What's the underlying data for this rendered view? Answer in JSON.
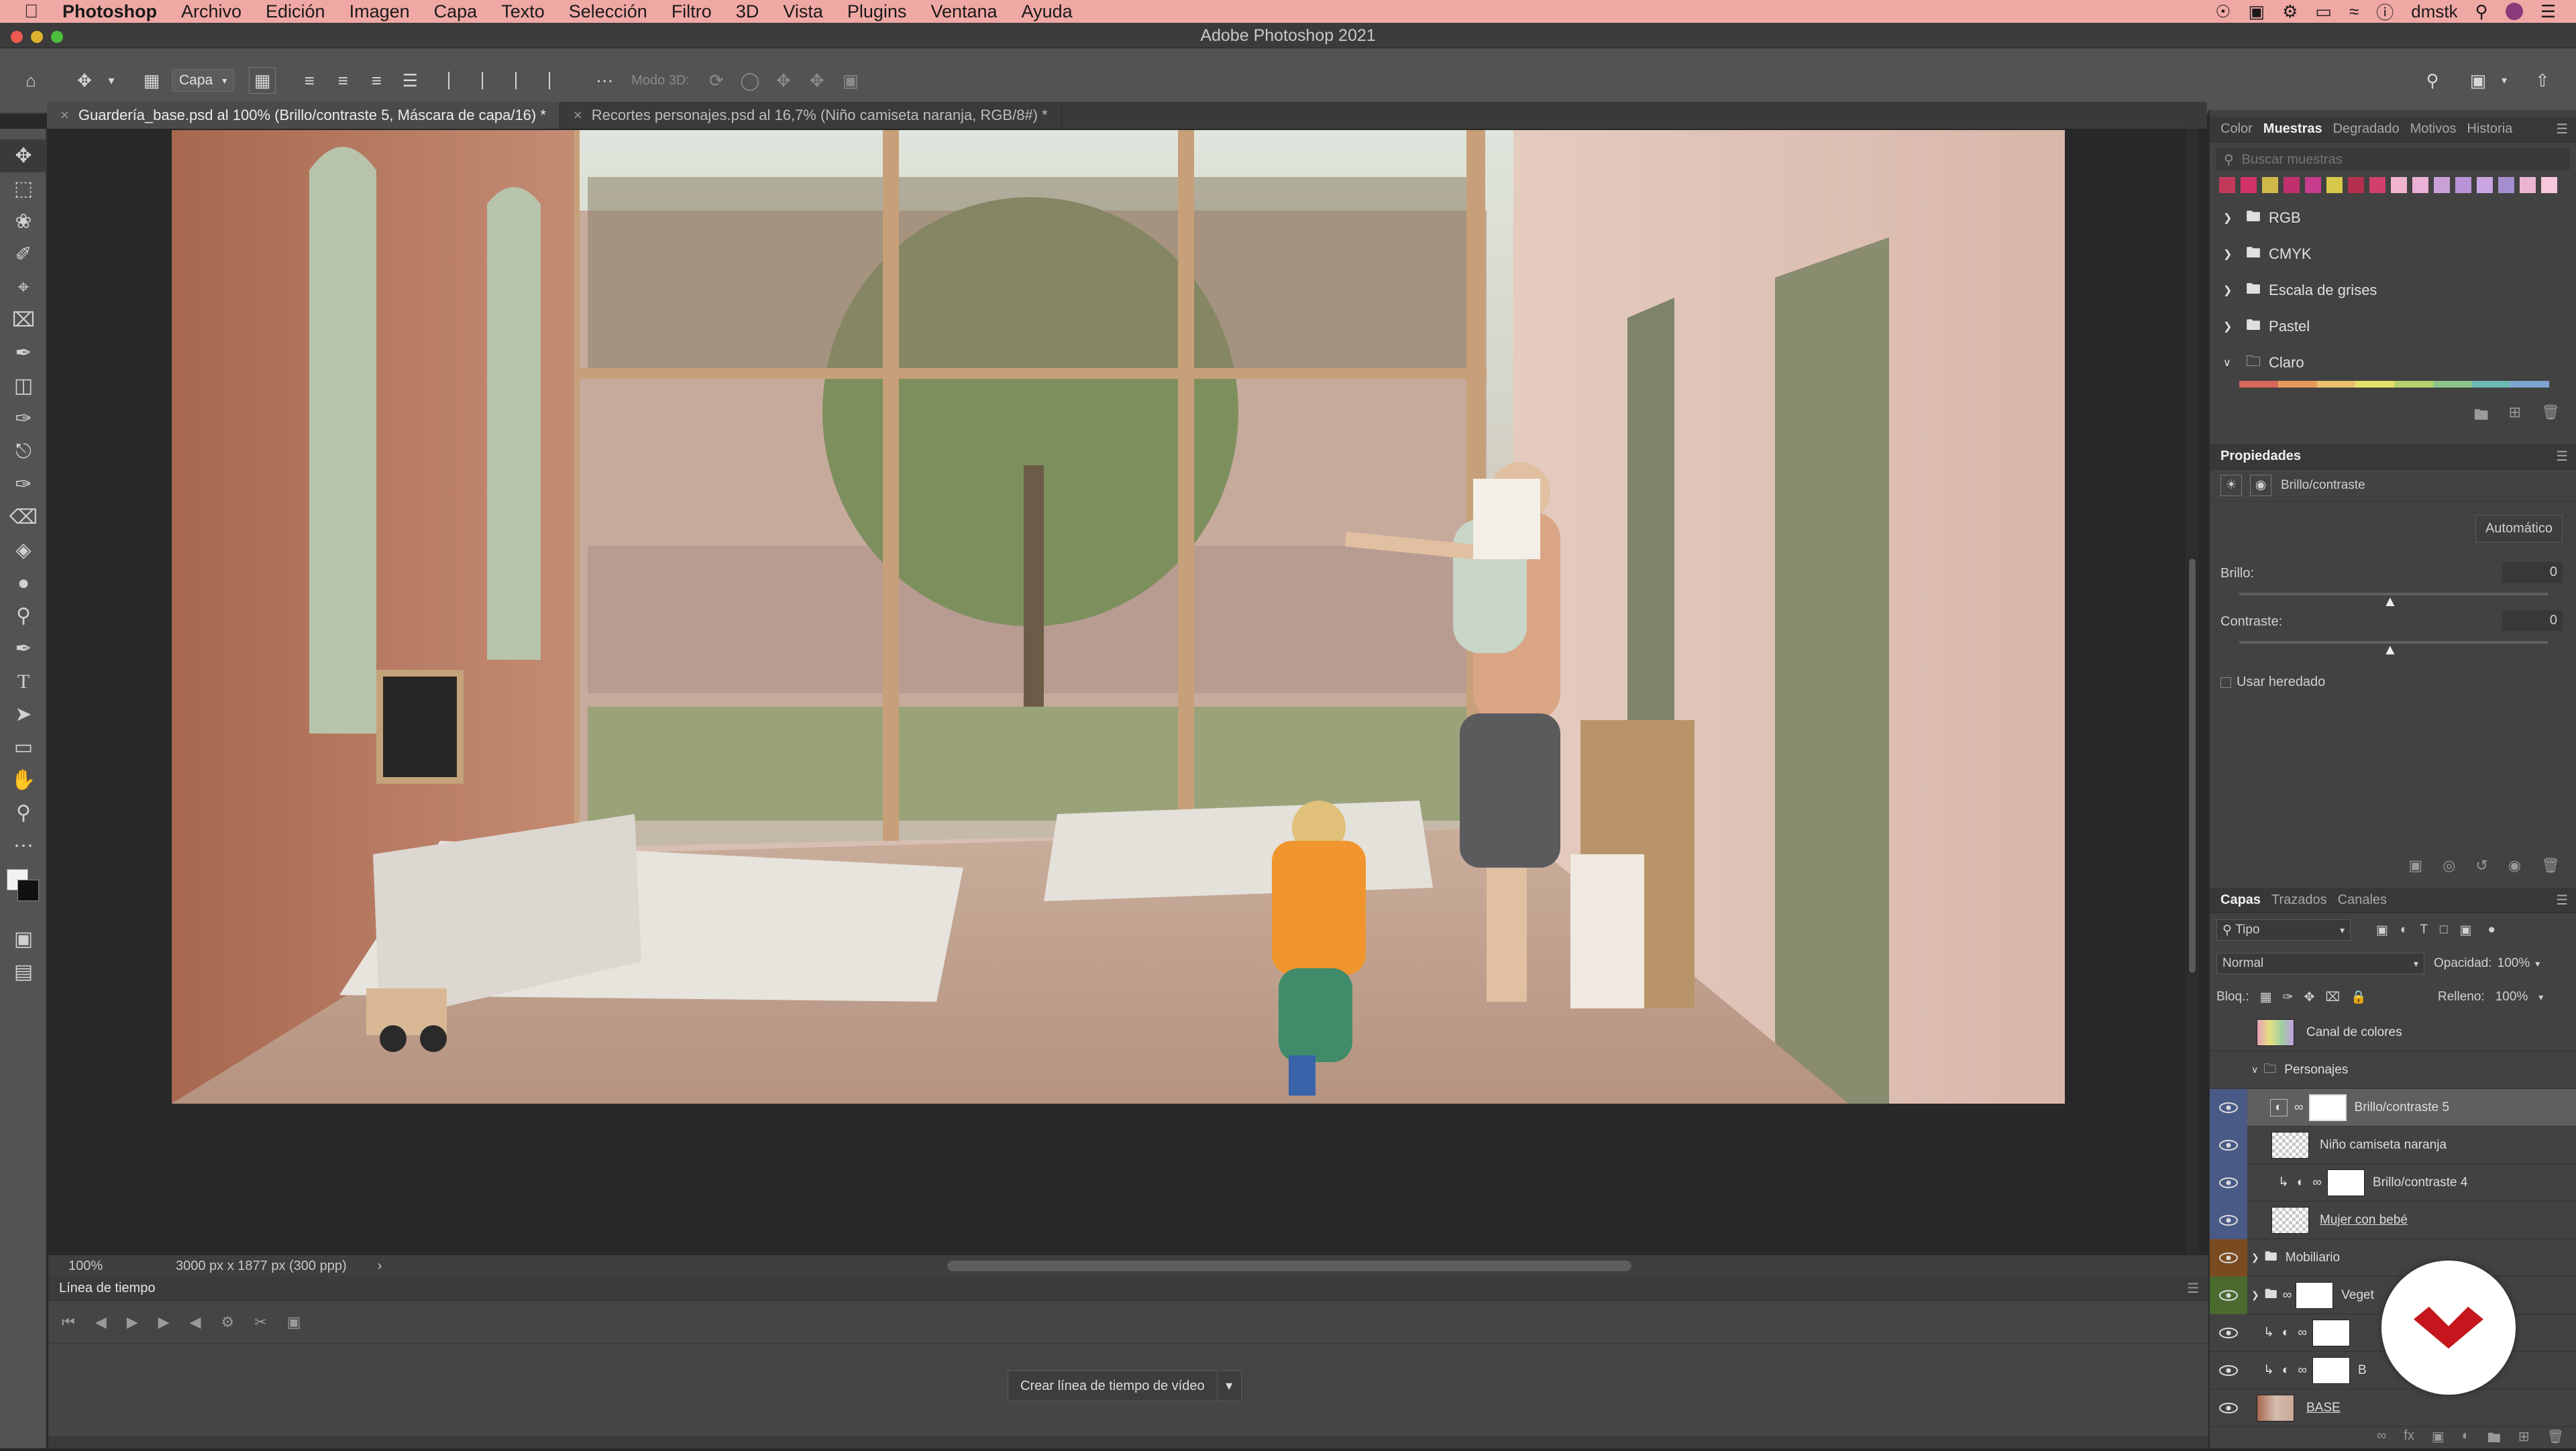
{
  "menubar": {
    "app_name": "Photoshop",
    "items": [
      "Archivo",
      "Edición",
      "Imagen",
      "Capa",
      "Texto",
      "Selección",
      "Filtro",
      "3D",
      "Vista",
      "Plugins",
      "Ventana",
      "Ayuda"
    ],
    "user": "dmstk"
  },
  "window": {
    "title": "Adobe Photoshop 2021"
  },
  "options_bar": {
    "layer_select": "Capa",
    "mode3d": "Modo 3D:"
  },
  "tabs": [
    {
      "label": "Guardería_base.psd al 100% (Brillo/contraste 5, Máscara de capa/16) *",
      "active": true
    },
    {
      "label": "Recortes personajes.psd al 16,7% (Niño camiseta naranja, RGB/8#) *",
      "active": false
    }
  ],
  "status": {
    "zoom": "100%",
    "doc_info": "3000 px x 1877 px (300 ppp)",
    "arrow": "›"
  },
  "timeline": {
    "title": "Línea de tiempo",
    "create_button": "Crear línea de tiempo de vídeo"
  },
  "swatches_panel": {
    "tabs": [
      "Color",
      "Muestras",
      "Degradado",
      "Motivos",
      "Historia"
    ],
    "active_tab": "Muestras",
    "search_placeholder": "Buscar muestras",
    "colors": [
      "#c23a5a",
      "#d33468",
      "#d0b84a",
      "#c22f6e",
      "#c53d8c",
      "#d7c84a",
      "#b5304c",
      "#d0406a",
      "#f0b4cc",
      "#eab0d6",
      "#c9a0d8",
      "#b894d6",
      "#c8a4e0",
      "#a48ecf",
      "#eab4d2",
      "#f6c6dc"
    ],
    "folders": [
      "RGB",
      "CMYK",
      "Escala de grises",
      "Pastel",
      "Claro"
    ],
    "strip_colors": [
      "#d7675a",
      "#e69a5c",
      "#eac16a",
      "#e8e06c",
      "#b6d26c",
      "#8cc48a",
      "#6cb8b4",
      "#7ea4d0"
    ]
  },
  "properties_panel": {
    "title": "Propiedades",
    "type_label": "Brillo/contraste",
    "auto_button": "Automático",
    "brightness_label": "Brillo:",
    "brightness_value": "0",
    "contrast_label": "Contraste:",
    "contrast_value": "0",
    "legacy_label": "Usar heredado"
  },
  "layers_panel": {
    "tabs": [
      "Capas",
      "Trazados",
      "Canales"
    ],
    "active_tab": "Capas",
    "filter_kind": "Tipo",
    "blend_mode": "Normal",
    "opacity_label": "Opacidad:",
    "opacity_value": "100%",
    "lock_label": "Bloq.:",
    "fill_label": "Relleno:",
    "fill_value": "100%",
    "layers": [
      {
        "name": "Canal de colores",
        "visible": false,
        "kind": "layer"
      },
      {
        "name": "Personajes",
        "visible": false,
        "kind": "group-open"
      },
      {
        "name": "Brillo/contraste 5",
        "visible": true,
        "kind": "adjust",
        "selected": true
      },
      {
        "name": "Niño camiseta naranja",
        "visible": true,
        "kind": "layer"
      },
      {
        "name": "Brillo/contraste 4",
        "visible": true,
        "kind": "adjust"
      },
      {
        "name": "Mujer con bebé",
        "visible": true,
        "kind": "layer"
      },
      {
        "name": "Mobiliario",
        "visible": true,
        "kind": "group"
      },
      {
        "name": "Veget",
        "visible": true,
        "kind": "group"
      },
      {
        "name": "",
        "visible": true,
        "kind": "adjust"
      },
      {
        "name": "B",
        "visible": true,
        "kind": "adjust"
      },
      {
        "name": "BASE",
        "visible": true,
        "kind": "layer"
      }
    ]
  },
  "colors": {
    "menubar": "#f0a8a4",
    "accent": "#c4161c",
    "blue_row": "#4a5a86",
    "orange_row": "#7a4a20",
    "green_row": "#4a6a30"
  }
}
